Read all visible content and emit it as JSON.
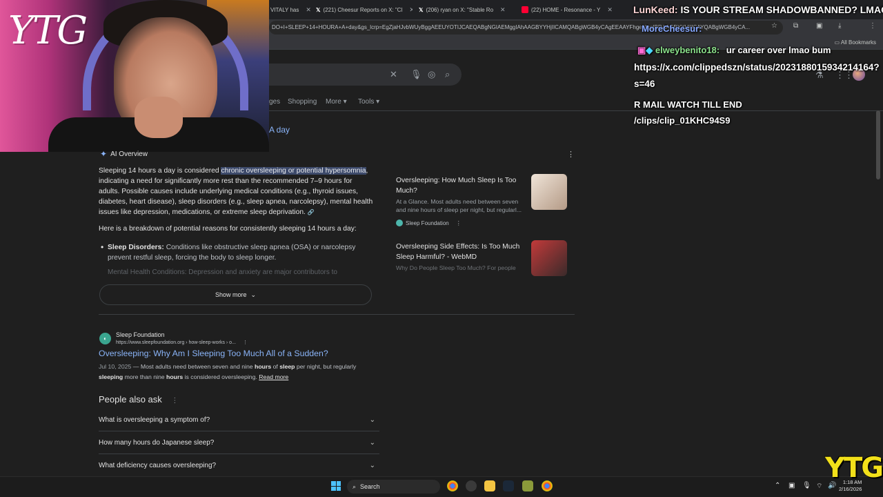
{
  "browser": {
    "tabs": [
      {
        "label": "VITALY has",
        "icon": "tab-icon"
      },
      {
        "label": "(221) Cheesur Reports on X: \"Cl",
        "icon": "x-logo-icon"
      },
      {
        "label": "(206) ryan on X: \"Stable Ro",
        "icon": "x-logo-icon"
      },
      {
        "label": "(22) HOME - Resonance - Y",
        "icon": "youtube-icon"
      }
    ],
    "url": "DO+I+SLEEP+14+HOURA+A+day&gs_lcrp=EgZjaHJvbWUyBggAEEUYOTIJCAEQABgNGIAEMggIAhAAGBYYHjIICAMQABgWGB4yCAgEEAAYFhgeMggIBRAAGBYYHjIICAYQABgWGB4yCA...",
    "bookmarks_label": "All Bookmarks"
  },
  "search": {
    "nav_tabs": [
      "ges",
      "Shopping",
      "More",
      "Tools"
    ],
    "query_tail": "A day"
  },
  "chat": {
    "line1_user": "LunKeed:",
    "line1_text": "IS YOUR STREAM SHADOWBANNED? LMAO",
    "line2_user": "MoreCheesur:",
    "line3_user": "elweybenito18:",
    "line3_text": "ur career over lmao bum",
    "line4_text": "https://x.com/clippedszn/status/2023188015934214164?",
    "line5_text": "s=46",
    "line6_text": "R MAIL WATCH TILL END",
    "line7_text": "/clips/clip_01KHC94S9"
  },
  "overlay": {
    "logo_text": "YTG",
    "corner_logo": "YTG"
  },
  "ai_overview": {
    "title": "AI Overview",
    "para_start": "Sleeping 14 hours a day is considered ",
    "para_highlight": "chronic oversleeping or potential hypersomnia",
    "para_rest": ", indicating a need for significantly more rest than the recommended 7–9 hours for adults. Possible causes include underlying medical conditions (e.g., thyroid issues, diabetes, heart disease), sleep disorders (e.g., sleep apnea, narcolepsy), mental health issues like depression, medications, or extreme sleep deprivation.",
    "breakdown": "Here is a breakdown of potential reasons for consistently sleeping 14 hours a day:",
    "bullet_bold": "Sleep Disorders:",
    "bullet_text": " Conditions like obstructive sleep apnea (OSA) or narcolepsy prevent restful sleep, forcing the body to sleep longer.",
    "faded_text": "Mental Health Conditions: Depression and anxiety are major contributors to",
    "show_more": "Show more",
    "cards": [
      {
        "title": "Oversleeping: How Much Sleep Is Too Much?",
        "desc": "At a Glance. Most adults need between seven and nine hours of sleep per night, but regularl...",
        "source": "Sleep Foundation"
      },
      {
        "title": "Oversleeping Side Effects: Is Too Much Sleep Harmful? - WebMD",
        "desc": "Why Do People Sleep Too Much? For people"
      }
    ]
  },
  "result": {
    "site": "Sleep Foundation",
    "url": "https://www.sleepfoundation.org › how-sleep-works › o...",
    "title": "Oversleeping: Why Am I Sleeping Too Much All of a Sudden?",
    "date": "Jul 10, 2025",
    "snip_a": " — Most adults need between seven and nine ",
    "snip_b1": "hours",
    "snip_c": " of ",
    "snip_b2": "sleep",
    "snip_d": " per night, but regularly ",
    "snip_b3": "sleeping",
    "snip_e": " more than nine ",
    "snip_b4": "hours",
    "snip_f": " is considered oversleeping. ",
    "read_more": "Read more"
  },
  "people_also_ask": {
    "title": "People also ask",
    "questions": [
      "What is oversleeping a symptom of?",
      "How many hours do Japanese sleep?",
      "What deficiency causes oversleeping?"
    ]
  },
  "taskbar": {
    "search_label": "Search",
    "time": "1:18 AM",
    "date": "2/16/2026"
  }
}
